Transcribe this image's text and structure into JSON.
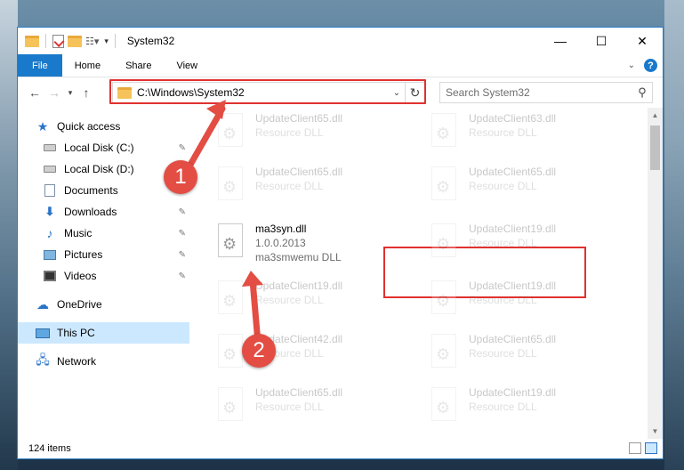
{
  "window": {
    "title": "System32"
  },
  "ribbon": {
    "tabs": [
      "File",
      "Home",
      "Share",
      "View"
    ]
  },
  "nav": {
    "address": "C:\\Windows\\System32",
    "search_placeholder": "Search System32"
  },
  "sidebar": {
    "items": [
      {
        "label": "Quick access",
        "icon": "star-icon",
        "pinned": false
      },
      {
        "label": "Local Disk (C:)",
        "icon": "disk-icon",
        "pinned": true
      },
      {
        "label": "Local Disk (D:)",
        "icon": "disk-icon",
        "pinned": false
      },
      {
        "label": "Documents",
        "icon": "documents-icon",
        "pinned": true
      },
      {
        "label": "Downloads",
        "icon": "download-icon",
        "pinned": true
      },
      {
        "label": "Music",
        "icon": "music-icon",
        "pinned": true
      },
      {
        "label": "Pictures",
        "icon": "pictures-icon",
        "pinned": true
      },
      {
        "label": "Videos",
        "icon": "videos-icon",
        "pinned": true
      },
      {
        "label": "OneDrive",
        "icon": "cloud-icon",
        "pinned": false
      },
      {
        "label": "This PC",
        "icon": "computer-icon",
        "pinned": false,
        "selected": true
      },
      {
        "label": "Network",
        "icon": "network-icon",
        "pinned": false
      }
    ]
  },
  "files": [
    {
      "name": "UpdateClient65.dll",
      "type": "Resource DLL"
    },
    {
      "name": "UpdateClient63.dll",
      "type": "Resource DLL"
    },
    {
      "name": "UpdateClient65.dll",
      "type": "Resource DLL"
    },
    {
      "name": "UpdateClient65.dll",
      "type": "Resource DLL"
    },
    {
      "name": "ma3syn.dll",
      "version": "1.0.0.2013",
      "type": "ma3smwemu DLL"
    },
    {
      "name": "UpdateClient19.dll",
      "type": "Resource DLL"
    },
    {
      "name": "UpdateClient19.dll",
      "type": "Resource DLL"
    },
    {
      "name": "UpdateClient19.dll",
      "type": "Resource DLL"
    },
    {
      "name": "UpdateClient42.dll",
      "type": "Resource DLL"
    },
    {
      "name": "UpdateClient65.dll",
      "type": "Resource DLL"
    },
    {
      "name": "UpdateClient65.dll",
      "type": "Resource DLL"
    },
    {
      "name": "UpdateClient19.dll",
      "type": "Resource DLL"
    }
  ],
  "status": {
    "item_count": "124 items"
  },
  "annotations": {
    "marker1": "1",
    "marker2": "2",
    "color": "#e0312f"
  }
}
